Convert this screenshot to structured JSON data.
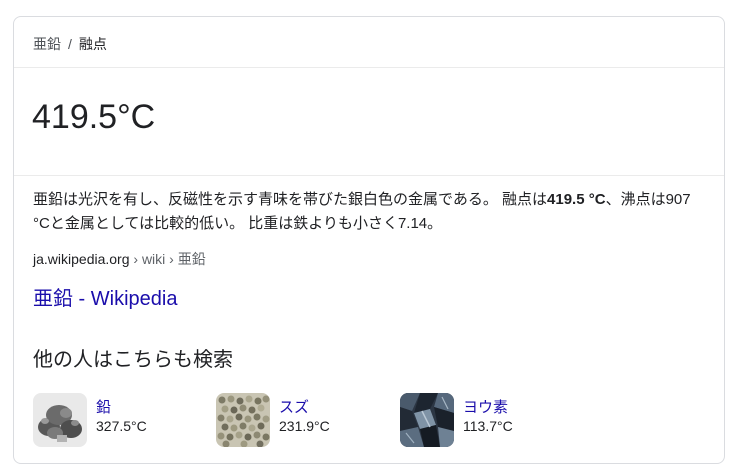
{
  "breadcrumb": {
    "parent": "亜鉛",
    "separator": "/",
    "current": "融点"
  },
  "answer": {
    "value": "419.5°C"
  },
  "snippet": {
    "text_before": "亜鉛は光沢を有し、反磁性を示す青味を帯びた銀白色の金属である。 融点は",
    "bold": "419.5 °C",
    "text_after": "、沸点は907 °Cと金属としては比較的低い。 比重は鉄よりも小さく7.14。"
  },
  "source": {
    "domain": "ja.wikipedia.org",
    "path": " › wiki › 亜鉛"
  },
  "result_link": {
    "title": "亜鉛 - Wikipedia"
  },
  "related": {
    "heading": "他の人はこちらも検索",
    "items": [
      {
        "name": "鉛",
        "value": "327.5°C",
        "image": "lead-photo"
      },
      {
        "name": "スズ",
        "value": "231.9°C",
        "image": "tin-photo"
      },
      {
        "name": "ヨウ素",
        "value": "113.7°C",
        "image": "iodine-photo"
      }
    ]
  },
  "colors": {
    "link": "#1a0dab",
    "text": "#202124",
    "muted": "#5f6368",
    "border": "#dadce0"
  }
}
